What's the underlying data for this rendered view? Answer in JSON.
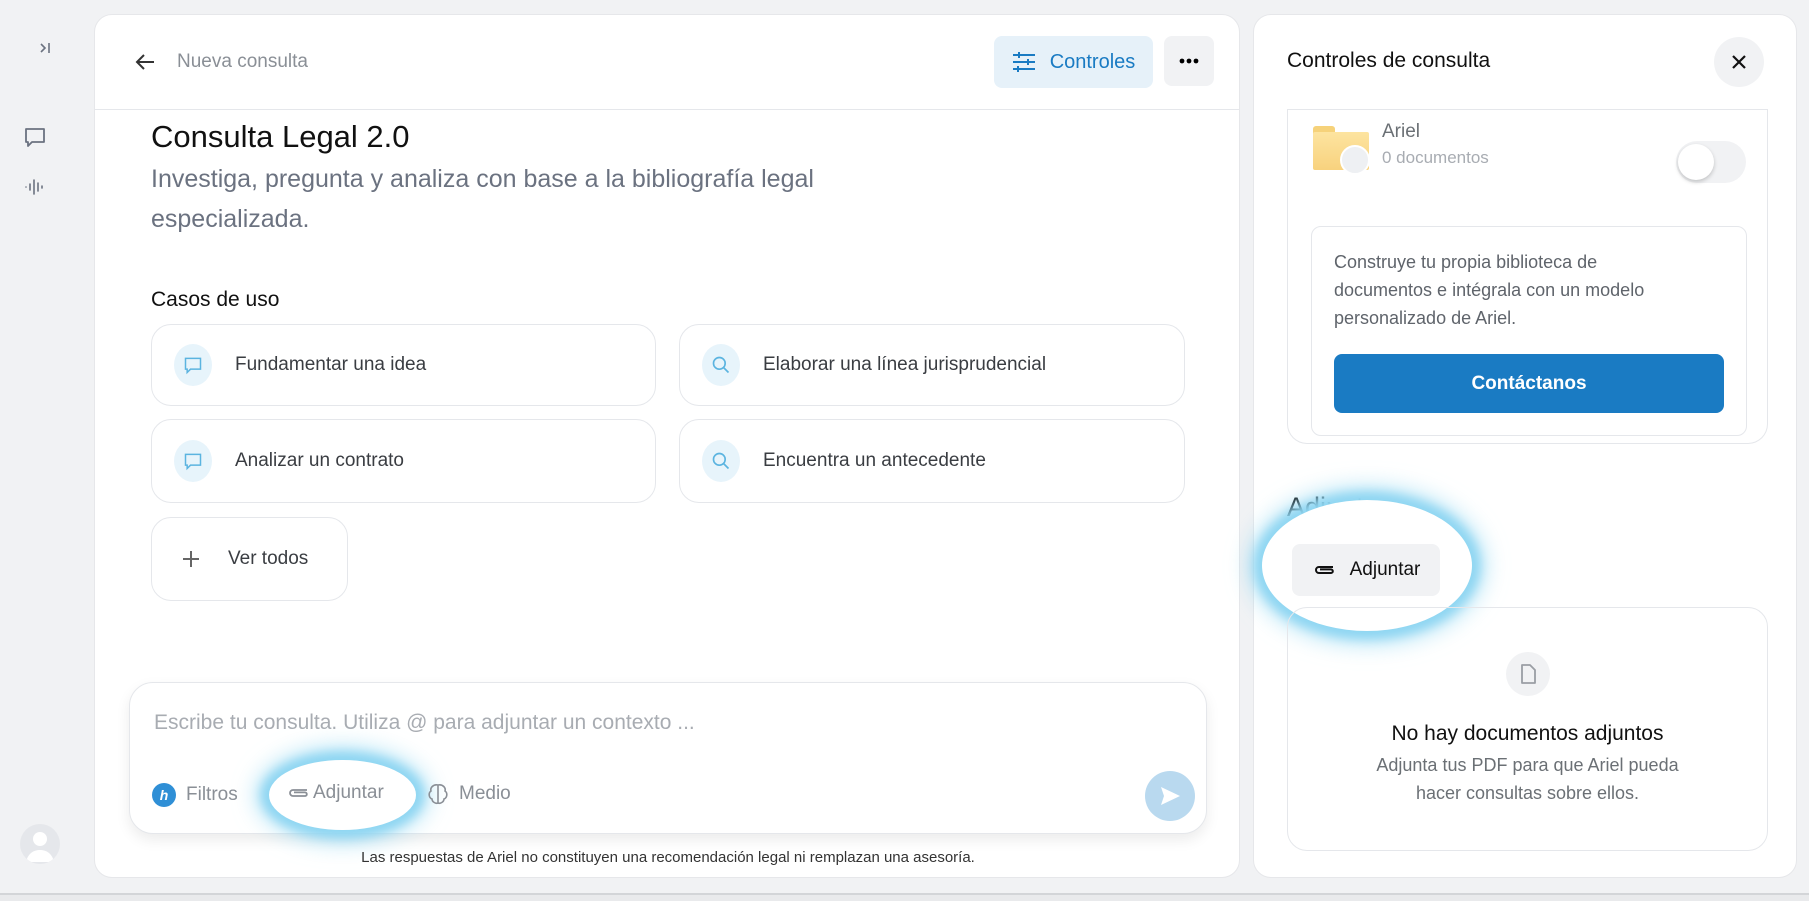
{
  "sidebar": {
    "items": [
      {
        "icon": "expand-sidebar-icon"
      },
      {
        "icon": "chat-icon"
      },
      {
        "icon": "audio-waveform-icon"
      },
      {
        "icon": "user-avatar-icon"
      }
    ]
  },
  "header": {
    "back_label": "Nueva consulta",
    "controls_label": "Controles",
    "accent": "#1a7bc3"
  },
  "main": {
    "title": "Consulta Legal 2.0",
    "subtitle_line1": "Investiga, pregunta y analiza con base a la bibliografía legal",
    "subtitle_line2": "especializada.",
    "use_cases_heading": "Casos de uso",
    "use_cases": [
      {
        "label": "Fundamentar una idea",
        "icon": "chat-icon"
      },
      {
        "label": "Elaborar una línea jurisprudencial",
        "icon": "search-icon"
      },
      {
        "label": "Analizar un contrato",
        "icon": "chat-icon"
      },
      {
        "label": "Encuentra un antecedente",
        "icon": "search-icon"
      }
    ],
    "see_all_label": "Ver todos"
  },
  "composer": {
    "placeholder": "Escribe tu consulta. Utiliza @ para adjuntar un contexto ...",
    "filters_label": "Filtros",
    "attach_label": "Adjuntar",
    "mode_label": "Medio",
    "disclaimer": "Las respuestas de Ariel no constituyen una recomendación legal ni remplazan una asesoría."
  },
  "controls_panel": {
    "title": "Controles de consulta",
    "library": {
      "name": "Ariel",
      "count": "0 documentos",
      "enabled": false
    },
    "promo_text_lines": [
      "Construye tu propia biblioteca de",
      "documentos e intégrala con un modelo",
      "personalizado de Ariel."
    ],
    "contact_label": "Contáctanos",
    "attachments_heading": "Adjuntos",
    "attach_label": "Adjuntar",
    "empty_title": "No hay documentos adjuntos",
    "empty_lines": [
      "Adjunta tus PDF para que Ariel pueda",
      "hacer consultas sobre ellos."
    ]
  }
}
